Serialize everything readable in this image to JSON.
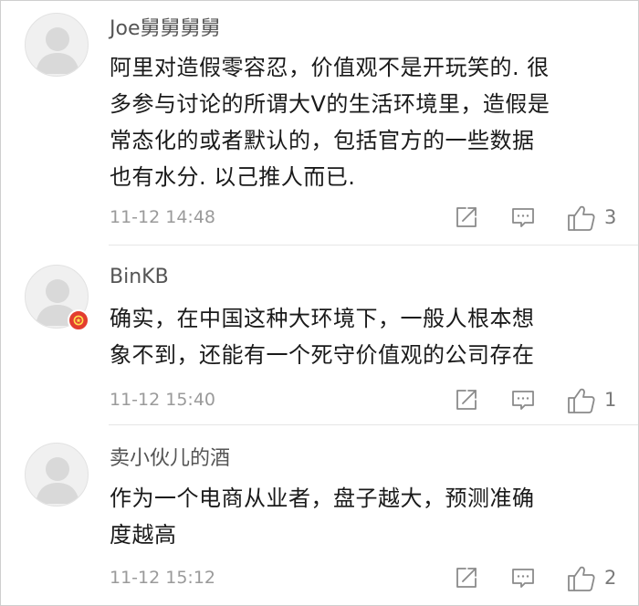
{
  "comments": [
    {
      "username": "Joe舅舅舅舅",
      "content": "阿里对造假零容忍，价值观不是开玩笑的. 很\n多参与讨论的所谓大V的生活环境里，造假是\n常态化的或者默认的，包括官方的一些数据\n也有水分. 以己推人而已.",
      "time": "11-12 14:48",
      "likes": "3",
      "verified": false
    },
    {
      "username": "BinKB",
      "content": "确实，在中国这种大环境下，一般人根本想\n象不到，还能有一个死守价值观的公司存在",
      "time": "11-12 15:40",
      "likes": "1",
      "verified": true
    },
    {
      "username": "卖小伙儿的酒",
      "content": "作为一个电商从业者，盘子越大，预测准确\n度越高",
      "time": "11-12 15:12",
      "likes": "2",
      "verified": false
    }
  ],
  "icons": {
    "avatar": "default-avatar-icon",
    "forward": "forward-icon",
    "reply": "comment-icon",
    "like": "thumbs-up-icon",
    "verified": "verified-badge-icon"
  },
  "colors": {
    "username": "#555555",
    "content": "#1a1a1a",
    "meta": "#9a9a9a",
    "badge": "#e33d2f",
    "avatar_bg": "#f0f0f0"
  }
}
